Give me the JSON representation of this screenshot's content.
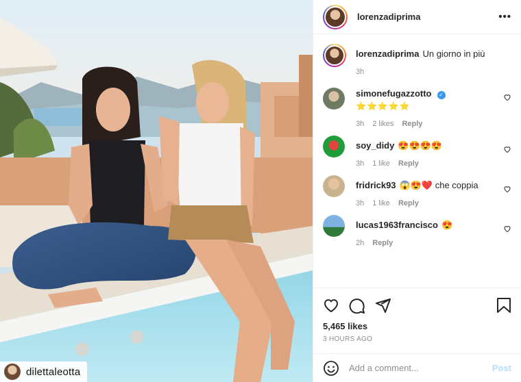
{
  "photo": {
    "watermark": "dilettaleotta"
  },
  "header": {
    "username": "lorenzadiprima",
    "more": "•••"
  },
  "caption": {
    "username": "lorenzadiprima",
    "text": "Un giorno in più",
    "time": "3h"
  },
  "comments": [
    {
      "username": "simonefugazzotto",
      "verified": true,
      "text": "⭐⭐⭐⭐⭐",
      "time": "3h",
      "likes": "2 likes",
      "reply": "Reply",
      "avatar_color": "#6e7a61"
    },
    {
      "username": "soy_didy",
      "verified": false,
      "text": "😍😍😍😍",
      "time": "3h",
      "likes": "1 like",
      "reply": "Reply",
      "avatar_color": "#1f9d3a"
    },
    {
      "username": "fridrick93",
      "verified": false,
      "text": "😱😍❤️ che coppia",
      "time": "3h",
      "likes": "1 like",
      "reply": "Reply",
      "avatar_color": "#c9b28e"
    },
    {
      "username": "lucas1963francisco",
      "verified": false,
      "text": "😍",
      "time": "2h",
      "likes": "",
      "reply": "Reply",
      "avatar_color": "#3a78b8"
    }
  ],
  "footer": {
    "likes": "5,465 likes",
    "ago": "3 HOURS AGO",
    "comment_placeholder": "Add a comment...",
    "post": "Post"
  },
  "colors": {
    "accent_verified": "#3897f0",
    "post_disabled": "#b2dffc",
    "muted": "#8e8e8e"
  }
}
